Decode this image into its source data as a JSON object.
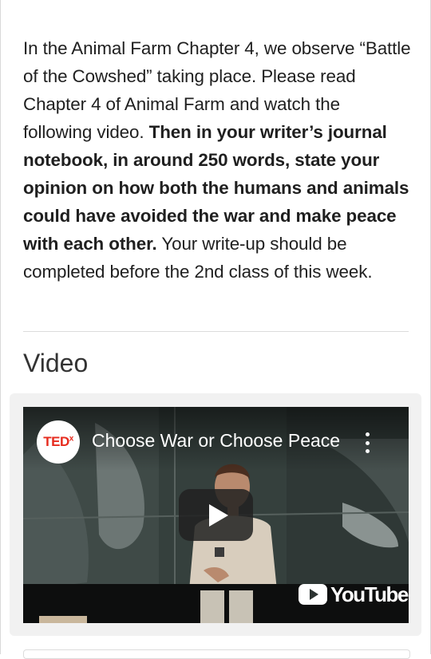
{
  "assignment": {
    "intro": "In the Animal Farm Chapter 4, we observe “Battle of the Cowshed” taking place. Please read Chapter 4 of Animal Farm and watch the following video. ",
    "bold_instruction": "Then in your writer’s journal notebook, in around 250 words, state your opinion on how both the humans and animals could have avoided the war and make peace with each other.",
    "outro": " Your write-up should be completed before the 2nd class of this week."
  },
  "video_section": {
    "heading": "Video",
    "player": {
      "channel_logo_text": "TED",
      "channel_logo_sup": "x",
      "title": "Choose War or Choose Peace",
      "menu_icon": "more-vertical-icon",
      "play_icon": "play-icon",
      "watermark_text": "YouTube",
      "colors": {
        "ted_red": "#e62b1e",
        "overlay": "#212121"
      }
    }
  }
}
